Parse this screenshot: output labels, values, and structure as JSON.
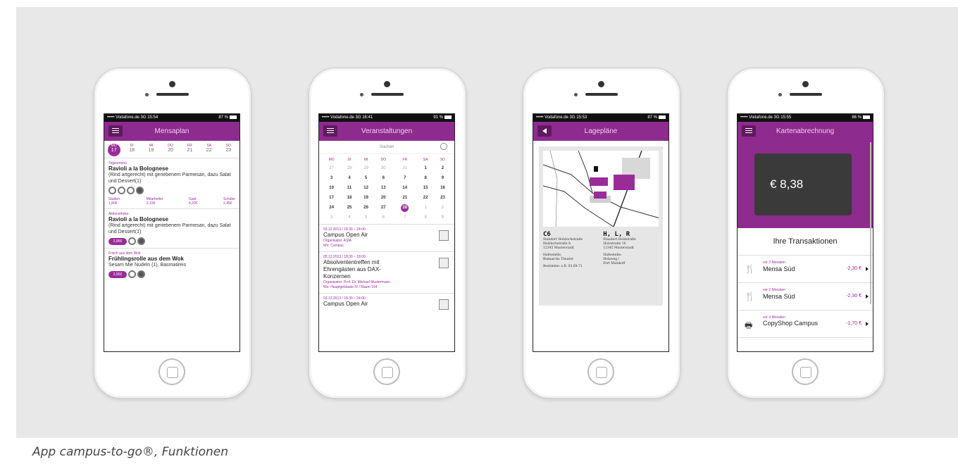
{
  "caption": "App campus-to-go®, Funktionen",
  "phones": [
    {
      "status": {
        "carrier": "••••• Vodafone.de  3G  15:54",
        "battery": "87 %"
      },
      "title": "Mensaplan",
      "days": [
        {
          "d": "MO",
          "n": "17"
        },
        {
          "d": "DI",
          "n": "18"
        },
        {
          "d": "MI",
          "n": "19"
        },
        {
          "d": "DO",
          "n": "20"
        },
        {
          "d": "FR",
          "n": "21"
        },
        {
          "d": "SA",
          "n": "22"
        },
        {
          "d": "SO",
          "n": "23"
        }
      ],
      "meals": [
        {
          "cat": "Tagesmenü",
          "title": "Ravioli a la Bolognese",
          "desc": "(Rind artgerecht) mit geriebenem Parmesan, dazu Salat und Dessert(1)"
        },
        {
          "cat": "Aktionstheke",
          "title": "Ravioli a la Bolognese",
          "desc": "(Rind artgerecht) mit geriebenem Parmesan, dazu Salat und Dessert(1)",
          "pill": "2,95€"
        },
        {
          "cat": "Frisch aus dem Wok",
          "title": "Frühlingsrolle aus dem Wok",
          "desc": "Sesam Mie Nudeln (1), Basmatireis",
          "pill": "2,95€"
        }
      ],
      "prices": [
        {
          "label": "Studen.",
          "value": "1,80€"
        },
        {
          "label": "Mitarbeiter",
          "value": "2,15€"
        },
        {
          "label": "Gast",
          "value": "4,20€"
        },
        {
          "label": "Schüler",
          "value": "2,45€"
        }
      ]
    },
    {
      "status": {
        "carrier": "••••• Vodafone.de  3G  16:41",
        "battery": "91 %"
      },
      "title": "Veranstaltungen",
      "search_placeholder": "Suchen",
      "weekdays": [
        "MO",
        "DI",
        "MI",
        "DO",
        "FR",
        "SA",
        "SO"
      ],
      "weeks": [
        [
          "27",
          "28",
          "29",
          "30",
          "31",
          "1",
          "2"
        ],
        [
          "3",
          "4",
          "5",
          "6",
          "7",
          "8",
          "9"
        ],
        [
          "10",
          "11",
          "12",
          "13",
          "14",
          "15",
          "16"
        ],
        [
          "17",
          "18",
          "19",
          "20",
          "21",
          "22",
          "23"
        ],
        [
          "24",
          "25",
          "26",
          "27",
          "28",
          "1",
          "2"
        ],
        [
          "3",
          "4",
          "5",
          "6",
          "7",
          "8",
          "9"
        ]
      ],
      "events": [
        {
          "date": "03.12.2013 / 18:30 – 24:00",
          "title": "Campus Open Air",
          "org": "Organisator: AStA",
          "place": "Wo: Campus"
        },
        {
          "date": "05.12.2013 / 18:30 – 18:00",
          "title": "Absolvententreffen mit Ehrengästen aus DAX-Konzernen",
          "org": "Organisator: Prof. Dr. Michael Mustermann",
          "place": "Wo: Hauptgebäude IV / Raum 104"
        },
        {
          "date": "03.12.2013 / 18:30 – 24:00",
          "title": "Campus Open Air",
          "org": "",
          "place": ""
        }
      ]
    },
    {
      "status": {
        "carrier": "••••• Vodafone.de  3G  15:53",
        "battery": "87 %"
      },
      "title": "Lagepläne",
      "locations": [
        {
          "code": "C6",
          "lines": [
            "Standort Holzlochstraße",
            "Holzlochstraße 8",
            "12345 Musterstadt",
            "",
            "Haltestelle:",
            "Bismarcks Theater",
            "",
            "Bestimme: z.B. 03.69.71"
          ]
        },
        {
          "code": "H, L, R",
          "lines": [
            "Standort Holzstraße",
            "Holzstraße 16",
            "12345 Musterstadt",
            "",
            "Haltestelle:",
            "Holzweg /",
            "Fort Malakoff"
          ]
        }
      ]
    },
    {
      "status": {
        "carrier": "••••• Vodafone.de  3G  15:55",
        "battery": "86 %"
      },
      "title": "Kartenabrechnung",
      "balance": "€ 8,38",
      "transactions_header": "Ihre Transaktionen",
      "transactions": [
        {
          "icon": "fork-knife-icon",
          "time": "vor 2 Monaten",
          "name": "Mensa Süd",
          "amount": "-2,30 €"
        },
        {
          "icon": "fork-knife-icon",
          "time": "vor 2 Monaten",
          "name": "Mensa Süd",
          "amount": "-2,30 €"
        },
        {
          "icon": "printer-icon",
          "time": "vor 3 Monaten",
          "name": "CopyShop Campus",
          "amount": "-1,70 €"
        }
      ]
    }
  ],
  "colors": {
    "accent": "#8e2b8e",
    "background": "#e8e8e8"
  }
}
